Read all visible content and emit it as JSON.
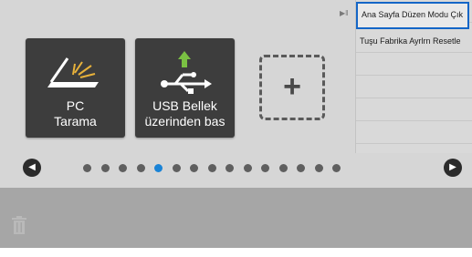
{
  "tiles": [
    {
      "label_line1": "PC",
      "label_line2": "Tarama",
      "icon": "scanner-icon"
    },
    {
      "label_line1": "USB Bellek",
      "label_line2": "üzerinden bas",
      "icon": "usb-icon"
    }
  ],
  "add_tile": {
    "symbol": "+",
    "icon": "add-icon"
  },
  "pagination": {
    "total": 15,
    "active_index": 4,
    "prev_icon": "chevron-left-icon",
    "next_icon": "chevron-right-icon"
  },
  "side_menu": {
    "collapse_icon": "collapse-arrow-icon",
    "items": [
      "Ana Sayfa Düzen Modu Çık",
      "Tuşu Fabrika Ayrlrn Resetle"
    ]
  },
  "bottom_bar": {
    "trash_icon": "trash-icon"
  },
  "colors": {
    "tile_bg": "#3d3d3d",
    "active_dot": "#1a83d6",
    "selection_border": "#1466c7",
    "usb_arrow": "#7ac143",
    "scanner_light": "#e8b23a"
  }
}
